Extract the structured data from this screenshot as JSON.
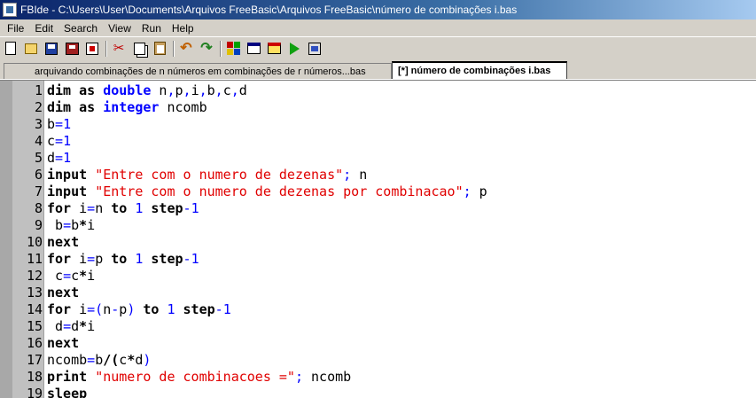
{
  "window": {
    "title": "FBIde - C:\\Users\\User\\Documents\\Arquivos FreeBasic\\Arquivos FreeBasic\\número de combinações i.bas"
  },
  "menu": [
    "File",
    "Edit",
    "Search",
    "View",
    "Run",
    "Help"
  ],
  "toolbar": {
    "icons": [
      "new-file-icon",
      "open-file-icon",
      "save-icon",
      "save-all-icon",
      "close-file-icon",
      "cut-icon",
      "copy-icon",
      "paste-icon",
      "undo-icon",
      "redo-icon",
      "compile-icon",
      "window-icon",
      "output-icon",
      "run-icon",
      "build-run-icon"
    ]
  },
  "tabs": [
    {
      "label": "arquivando combinações de n números em combinações de r números...bas",
      "active": false
    },
    {
      "label": "[*] número de combinações i.bas",
      "active": true
    }
  ],
  "colors": {
    "keyword": "#000000",
    "type": "#0000ff",
    "number": "#0000ff",
    "string": "#e00000",
    "gutter": "#c0c0c0"
  },
  "code": [
    {
      "n": "1",
      "tokens": [
        {
          "t": "dim",
          "c": "kw"
        },
        {
          "t": " as ",
          "c": "kw"
        },
        {
          "t": "double",
          "c": "ty"
        },
        {
          "t": " n",
          "c": "id"
        },
        {
          "t": ",",
          "c": "op"
        },
        {
          "t": "p",
          "c": "id"
        },
        {
          "t": ",",
          "c": "op"
        },
        {
          "t": "i",
          "c": "id"
        },
        {
          "t": ",",
          "c": "op"
        },
        {
          "t": "b",
          "c": "id"
        },
        {
          "t": ",",
          "c": "op"
        },
        {
          "t": "c",
          "c": "id"
        },
        {
          "t": ",",
          "c": "op"
        },
        {
          "t": "d",
          "c": "id"
        }
      ]
    },
    {
      "n": "2",
      "tokens": [
        {
          "t": "dim",
          "c": "kw"
        },
        {
          "t": " as ",
          "c": "kw"
        },
        {
          "t": "integer",
          "c": "ty"
        },
        {
          "t": " ncomb",
          "c": "id"
        }
      ]
    },
    {
      "n": "3",
      "tokens": [
        {
          "t": "b",
          "c": "id"
        },
        {
          "t": "=",
          "c": "op"
        },
        {
          "t": "1",
          "c": "num"
        }
      ]
    },
    {
      "n": "4",
      "tokens": [
        {
          "t": "c",
          "c": "id"
        },
        {
          "t": "=",
          "c": "op"
        },
        {
          "t": "1",
          "c": "num"
        }
      ]
    },
    {
      "n": "5",
      "tokens": [
        {
          "t": "d",
          "c": "id"
        },
        {
          "t": "=",
          "c": "op"
        },
        {
          "t": "1",
          "c": "num"
        }
      ]
    },
    {
      "n": "6",
      "tokens": [
        {
          "t": "input",
          "c": "kw"
        },
        {
          "t": " ",
          "c": "id"
        },
        {
          "t": "\"Entre com o numero de dezenas\"",
          "c": "str"
        },
        {
          "t": ";",
          "c": "op"
        },
        {
          "t": " n",
          "c": "id"
        }
      ]
    },
    {
      "n": "7",
      "tokens": [
        {
          "t": "input",
          "c": "kw"
        },
        {
          "t": " ",
          "c": "id"
        },
        {
          "t": "\"Entre com o numero de dezenas por combinacao\"",
          "c": "str"
        },
        {
          "t": ";",
          "c": "op"
        },
        {
          "t": " p",
          "c": "id"
        }
      ]
    },
    {
      "n": "8",
      "tokens": [
        {
          "t": "for",
          "c": "kw"
        },
        {
          "t": " i",
          "c": "id"
        },
        {
          "t": "=",
          "c": "op"
        },
        {
          "t": "n ",
          "c": "id"
        },
        {
          "t": "to",
          "c": "kw"
        },
        {
          "t": " ",
          "c": "id"
        },
        {
          "t": "1",
          "c": "num"
        },
        {
          "t": " ",
          "c": "id"
        },
        {
          "t": "step",
          "c": "kw"
        },
        {
          "t": "-",
          "c": "op"
        },
        {
          "t": "1",
          "c": "num"
        }
      ]
    },
    {
      "n": "9",
      "tokens": [
        {
          "t": " b",
          "c": "id"
        },
        {
          "t": "=",
          "c": "op"
        },
        {
          "t": "b",
          "c": "id"
        },
        {
          "t": "*",
          "c": "kw"
        },
        {
          "t": "i",
          "c": "id"
        }
      ]
    },
    {
      "n": "10",
      "tokens": [
        {
          "t": "next",
          "c": "kw"
        }
      ]
    },
    {
      "n": "11",
      "tokens": [
        {
          "t": "for",
          "c": "kw"
        },
        {
          "t": " i",
          "c": "id"
        },
        {
          "t": "=",
          "c": "op"
        },
        {
          "t": "p ",
          "c": "id"
        },
        {
          "t": "to",
          "c": "kw"
        },
        {
          "t": " ",
          "c": "id"
        },
        {
          "t": "1",
          "c": "num"
        },
        {
          "t": " ",
          "c": "id"
        },
        {
          "t": "step",
          "c": "kw"
        },
        {
          "t": "-",
          "c": "op"
        },
        {
          "t": "1",
          "c": "num"
        }
      ]
    },
    {
      "n": "12",
      "tokens": [
        {
          "t": " c",
          "c": "id"
        },
        {
          "t": "=",
          "c": "op"
        },
        {
          "t": "c",
          "c": "id"
        },
        {
          "t": "*",
          "c": "kw"
        },
        {
          "t": "i",
          "c": "id"
        }
      ]
    },
    {
      "n": "13",
      "tokens": [
        {
          "t": "next",
          "c": "kw"
        }
      ]
    },
    {
      "n": "14",
      "tokens": [
        {
          "t": "for",
          "c": "kw"
        },
        {
          "t": " i",
          "c": "id"
        },
        {
          "t": "=(",
          "c": "op"
        },
        {
          "t": "n",
          "c": "id"
        },
        {
          "t": "-",
          "c": "op"
        },
        {
          "t": "p",
          "c": "id"
        },
        {
          "t": ")",
          "c": "op"
        },
        {
          "t": " ",
          "c": "id"
        },
        {
          "t": "to",
          "c": "kw"
        },
        {
          "t": " ",
          "c": "id"
        },
        {
          "t": "1",
          "c": "num"
        },
        {
          "t": " ",
          "c": "id"
        },
        {
          "t": "step",
          "c": "kw"
        },
        {
          "t": "-",
          "c": "op"
        },
        {
          "t": "1",
          "c": "num"
        }
      ]
    },
    {
      "n": "15",
      "tokens": [
        {
          "t": " d",
          "c": "id"
        },
        {
          "t": "=",
          "c": "op"
        },
        {
          "t": "d",
          "c": "id"
        },
        {
          "t": "*",
          "c": "kw"
        },
        {
          "t": "i",
          "c": "id"
        }
      ]
    },
    {
      "n": "16",
      "tokens": [
        {
          "t": "next",
          "c": "kw"
        }
      ]
    },
    {
      "n": "17",
      "tokens": [
        {
          "t": "ncomb",
          "c": "id"
        },
        {
          "t": "=",
          "c": "op"
        },
        {
          "t": "b",
          "c": "id"
        },
        {
          "t": "/(",
          "c": "kw"
        },
        {
          "t": "c",
          "c": "id"
        },
        {
          "t": "*",
          "c": "kw"
        },
        {
          "t": "d",
          "c": "id"
        },
        {
          "t": ")",
          "c": "op"
        }
      ]
    },
    {
      "n": "18",
      "tokens": [
        {
          "t": "print",
          "c": "kw"
        },
        {
          "t": " ",
          "c": "id"
        },
        {
          "t": "\"numero de combinacoes =\"",
          "c": "str"
        },
        {
          "t": ";",
          "c": "op"
        },
        {
          "t": " ncomb",
          "c": "id"
        }
      ]
    },
    {
      "n": "19",
      "tokens": [
        {
          "t": "sleep",
          "c": "kw"
        }
      ]
    }
  ]
}
